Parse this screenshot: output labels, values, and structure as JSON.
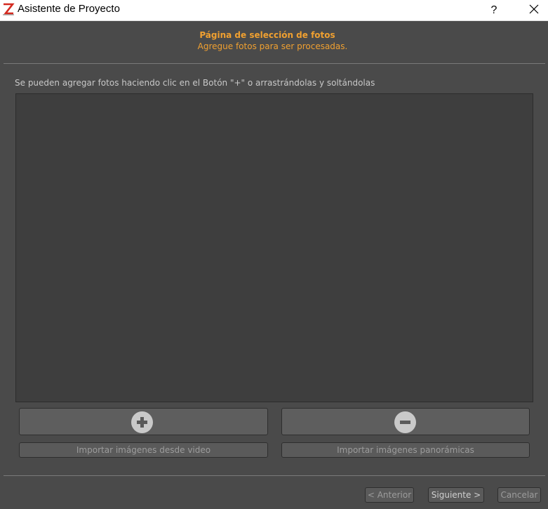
{
  "window": {
    "title": "Asistente de Proyecto",
    "help_label": "?",
    "icons": {
      "app": "z-logo-icon",
      "close": "close-icon"
    }
  },
  "header": {
    "title": "Página de selección de fotos",
    "subtitle": "Agregue fotos para ser procesadas."
  },
  "main": {
    "instructions": "Se pueden agregar fotos haciendo clic en el Botón \"+\" o arrastrándolas y soltándolas",
    "add_button_icon": "plus-circle-icon",
    "remove_button_icon": "minus-circle-icon",
    "import_video_label": "Importar imágenes desde video",
    "import_panoramic_label": "Importar imágenes panorámicas"
  },
  "footer": {
    "prev_label": "< Anterior",
    "next_label": "Siguiente >",
    "cancel_label": "Cancelar"
  },
  "colors": {
    "accent": "#f0a030",
    "background": "#4a4a4a",
    "photo_area": "#3e3e3e",
    "button": "#5e5e5e",
    "icon_fill": "#c9c9c9"
  }
}
